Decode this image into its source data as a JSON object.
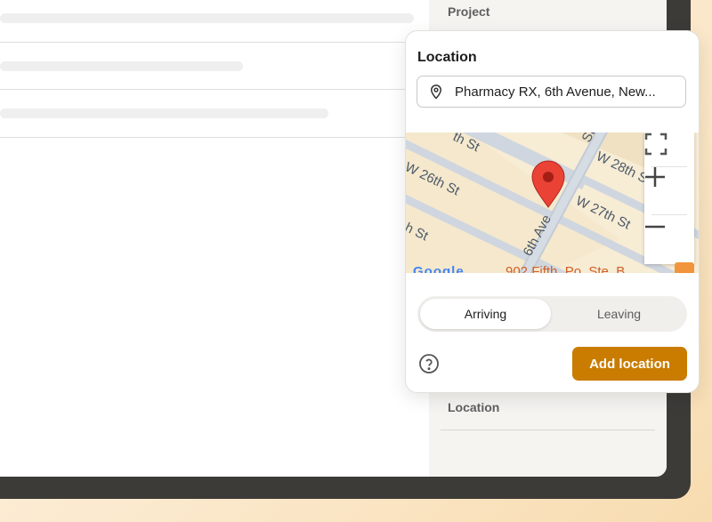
{
  "side_panel": {
    "project_label": "Project",
    "location_label": "Location"
  },
  "popover": {
    "title": "Location",
    "location_input": {
      "value": "Pharmacy RX, 6th Avenue, New...",
      "icon": "map-pin-icon"
    },
    "map": {
      "street_labels": [
        "W 28th St",
        "W 27th St",
        "W 26th St",
        "6th Ave",
        "th St",
        "h St",
        "St"
      ],
      "partial_address": "902 Fifth, Po. Ste. B",
      "attribution": "Google",
      "marker_color": "#ea4335",
      "controls": {
        "fullscreen_icon": "fullscreen-icon",
        "zoom_in_icon": "plus-icon",
        "zoom_out_icon": "minus-icon"
      }
    },
    "segmented": {
      "options": [
        "Arriving",
        "Leaving"
      ],
      "selected": "Arriving"
    },
    "help_icon": "question-circle-icon",
    "primary_button": "Add location",
    "accent_color": "#c97c00"
  }
}
